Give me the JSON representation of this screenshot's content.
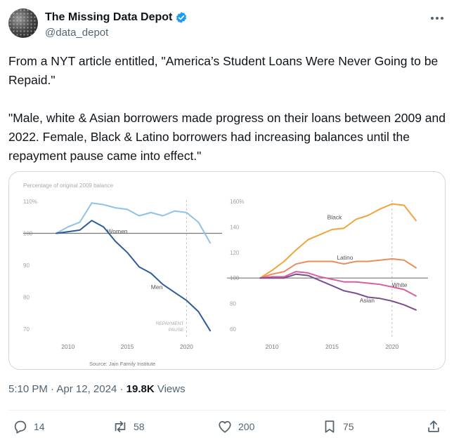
{
  "author": {
    "display_name": "The Missing Data Depot",
    "handle": "@data_depot",
    "verified_badge_icon": "verified-badge-icon"
  },
  "tweet": {
    "paragraphs": [
      "From a NYT article entitled, \"America’s Student Loans Were Never Going to be Repaid.\"",
      "\"Male, white & Asian borrowers made progress on their loans between 2009 and 2022. Female, Black & Latino borrowers had increasing balances until the repayment pause came into effect.\""
    ]
  },
  "meta": {
    "time": "5:10 PM",
    "date": "Apr 12, 2024",
    "views_count": "19.8K",
    "views_label": "Views"
  },
  "actions": {
    "replies": "14",
    "reposts": "58",
    "likes": "200",
    "bookmarks": "75"
  },
  "colors": {
    "accent_blue": "#1d9bf0",
    "secondary_text": "#536471",
    "women_line": "#8ec2e8",
    "men_line": "#2e5c99",
    "black_line": "#f2a43a",
    "latino_line": "#ec8b5e",
    "white_line": "#d85fa0",
    "asian_line": "#7a4f8e"
  },
  "chart_data": [
    {
      "type": "line",
      "ylabel": "Percentage of original 2009 balance",
      "ylim": [
        70,
        110
      ],
      "yticks": [
        70,
        80,
        90,
        100,
        110
      ],
      "ytick_labels": [
        "70",
        "80",
        "90",
        "100",
        "110%"
      ],
      "xlim": [
        2008,
        2023
      ],
      "xticks": [
        2010,
        2015,
        2020
      ],
      "reference_line": 100,
      "annotation": "REPAYMENT PAUSE",
      "annotation_x": 2020,
      "grid": false,
      "x": [
        2009,
        2010,
        2011,
        2012,
        2013,
        2014,
        2015,
        2016,
        2017,
        2018,
        2019,
        2020,
        2021,
        2022
      ],
      "series": [
        {
          "name": "Women",
          "values": [
            100,
            102,
            103.5,
            109.5,
            109,
            108,
            107.5,
            105.5,
            106.5,
            105.5,
            107,
            106.5,
            103.5,
            97
          ]
        },
        {
          "name": "Men",
          "values": [
            100,
            100.5,
            101,
            104,
            102,
            97.5,
            94,
            89.5,
            87.5,
            84,
            81.5,
            79,
            75.5,
            69.5
          ]
        }
      ]
    },
    {
      "type": "line",
      "ylim": [
        60,
        160
      ],
      "yticks": [
        60,
        80,
        100,
        120,
        140,
        160
      ],
      "ytick_labels": [
        "60",
        "80",
        "100",
        "120",
        "140",
        "160%"
      ],
      "xlim": [
        2008,
        2023
      ],
      "xticks": [
        2010,
        2015,
        2020
      ],
      "reference_line": 100,
      "annotation_x": 2020,
      "grid": false,
      "source": "Source: Jain Family Institute",
      "x": [
        2009,
        2010,
        2011,
        2012,
        2013,
        2014,
        2015,
        2016,
        2017,
        2018,
        2019,
        2020,
        2021,
        2022
      ],
      "series": [
        {
          "name": "Black",
          "values": [
            100,
            106,
            113,
            122,
            130,
            134,
            138,
            139,
            146,
            149,
            154,
            158,
            157,
            145
          ]
        },
        {
          "name": "Latino",
          "values": [
            100,
            103,
            105,
            111,
            113,
            113,
            113,
            111,
            113,
            113,
            114,
            115,
            114,
            108
          ]
        },
        {
          "name": "White",
          "values": [
            100,
            101,
            101,
            105,
            104,
            101,
            99,
            97,
            97,
            96,
            95,
            93,
            91,
            86
          ]
        },
        {
          "name": "Asian",
          "values": [
            100,
            100,
            100,
            103,
            102,
            98,
            94,
            90,
            88,
            85,
            84,
            82,
            79,
            75
          ]
        }
      ]
    }
  ]
}
